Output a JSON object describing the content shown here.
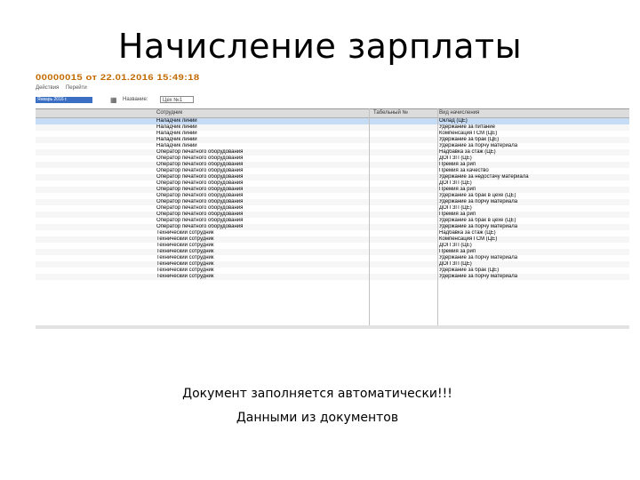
{
  "slide_title": "Начисление зарплаты",
  "document": {
    "header": "00000015 от 22.01.2016 15:49:18",
    "toolbar": [
      "Действия",
      "Перейти"
    ],
    "period_value": "Январь 2016 г.",
    "name_label": "Название:",
    "name_value": "Цех №1"
  },
  "grid": {
    "columns": [
      "Сотрудник",
      "Табельный №",
      "Вид начисления"
    ],
    "rows": [
      [
        "Наладчик линий",
        "",
        "Оклад (ЦЕ)"
      ],
      [
        "Наладчик линий",
        "",
        "Удержание за питание"
      ],
      [
        "Наладчик линий",
        "",
        "Компенсация ГСМ (ЦЕ)"
      ],
      [
        "Наладчик линий",
        "",
        "Удержание за брак (ЦЕ)"
      ],
      [
        "Наладчик линий",
        "",
        "Удержание за порчу материала"
      ],
      [
        "Оператор печатного оборудования",
        "",
        "Надбавка за стаж (ЦЕ)"
      ],
      [
        "Оператор печатного оборудования",
        "",
        "ДОП ЗП (ЦЕ)"
      ],
      [
        "Оператор печатного оборудования",
        "",
        "Премия за рип"
      ],
      [
        "Оператор печатного оборудования",
        "",
        "Премия за качество"
      ],
      [
        "Оператор печатного оборудования",
        "",
        "Удержание за недостачу материала"
      ],
      [
        "Оператор печатного оборудования",
        "",
        "ДОП ЗП (ЦЕ)"
      ],
      [
        "Оператор печатного оборудования",
        "",
        "Премия за рип"
      ],
      [
        "Оператор печатного оборудования",
        "",
        "Удержание за брак в цехе (ЦЕ)"
      ],
      [
        "Оператор печатного оборудования",
        "",
        "Удержание за порчу материала"
      ],
      [
        "Оператор печатного оборудования",
        "",
        "ДОП ЗП (ЦЕ)"
      ],
      [
        "Оператор печатного оборудования",
        "",
        "Премия за рип"
      ],
      [
        "Оператор печатного оборудования",
        "",
        "Удержание за брак в цехе (ЦЕ)"
      ],
      [
        "Оператор печатного оборудования",
        "",
        "Удержание за порчу материала"
      ],
      [
        "Технический сотрудник",
        "",
        "Надбавка за стаж (ЦЕ)"
      ],
      [
        "Технический сотрудник",
        "",
        "Компенсация ГСМ (ЦЕ)"
      ],
      [
        "Технический сотрудник",
        "",
        "ДОП ЗП (ЦЕ)"
      ],
      [
        "Технический сотрудник",
        "",
        "Премия за рип"
      ],
      [
        "Технический сотрудник",
        "",
        "Удержание за порчу материала"
      ],
      [
        "Технический сотрудник",
        "",
        "ДОП ЗП (ЦЕ)"
      ],
      [
        "Технический сотрудник",
        "",
        "Удержание за брак (ЦЕ)"
      ],
      [
        "Технический сотрудник",
        "",
        "Удержание за порчу материала"
      ]
    ]
  },
  "captions": [
    "Документ заполняется автоматически!!!",
    "Данными из документов"
  ]
}
